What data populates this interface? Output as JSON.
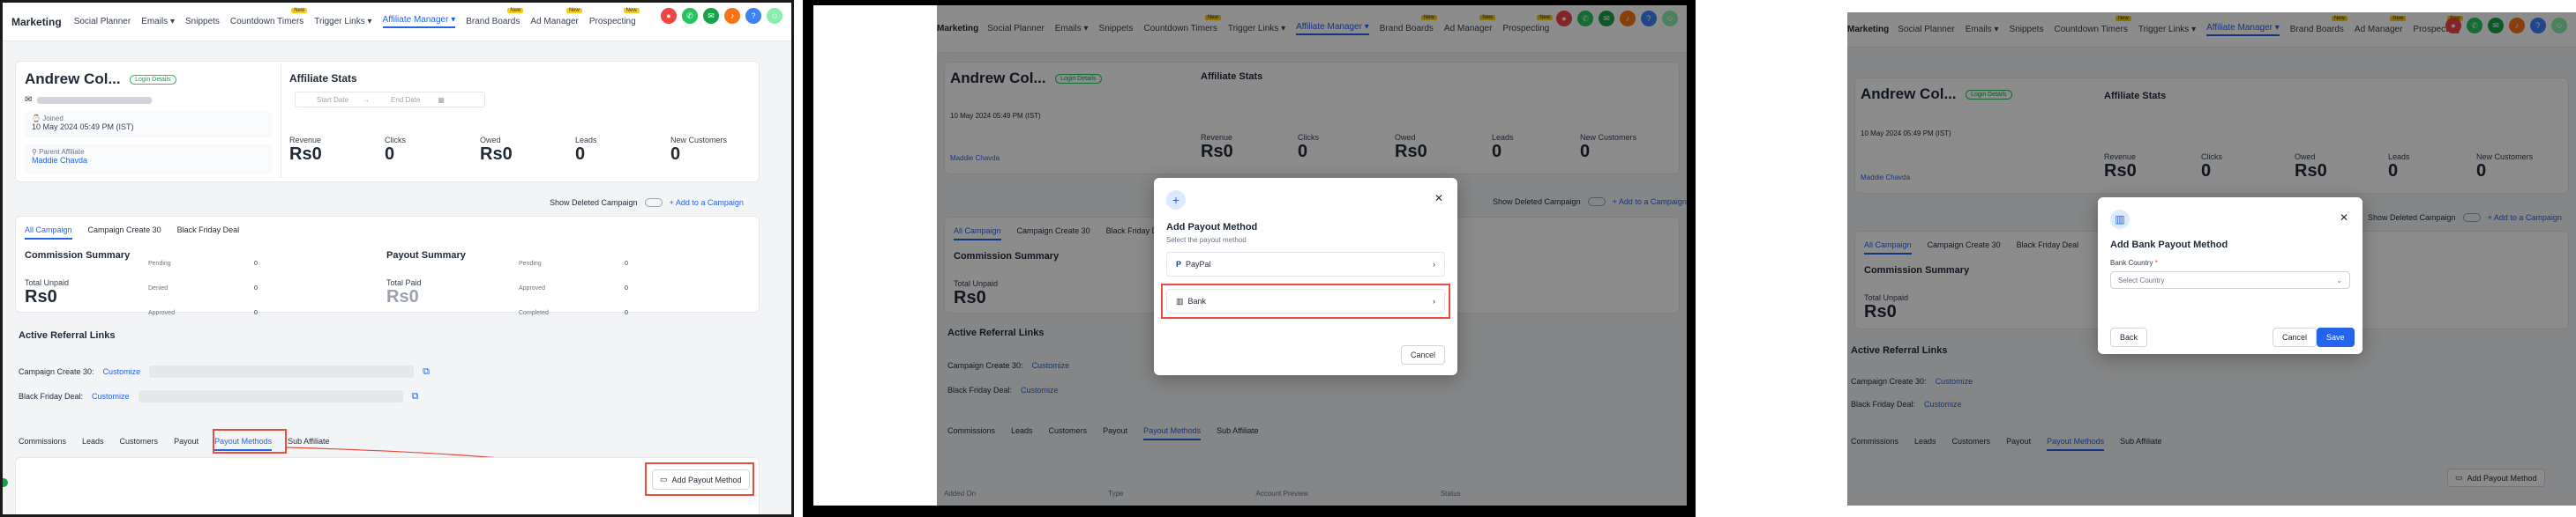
{
  "nav": {
    "brand": "Marketing",
    "items": [
      "Social Planner",
      "Emails",
      "Snippets",
      "Countdown Timers",
      "Trigger Links",
      "Affiliate Manager",
      "Brand Boards",
      "Ad Manager",
      "Prospecting"
    ],
    "new_badge": "New",
    "chevron": "▾"
  },
  "profile": {
    "name": "Andrew Col...",
    "login_details": "Login Details",
    "joined_label": "Joined",
    "joined_value": "10 May 2024 05:49 PM (IST)",
    "parent_label": "Parent Affiliate",
    "parent_value": "Maddie Chavda"
  },
  "stats": {
    "title": "Affiliate Stats",
    "start_placeholder": "Start Date",
    "end_placeholder": "End Date",
    "items": [
      {
        "label": "Revenue",
        "value": "Rs0"
      },
      {
        "label": "Clicks",
        "value": "0"
      },
      {
        "label": "Owed",
        "value": "Rs0"
      },
      {
        "label": "Leads",
        "value": "0"
      },
      {
        "label": "New Customers",
        "value": "0"
      }
    ]
  },
  "campaign_bar": {
    "show_deleted": "Show Deleted Campaign",
    "add_campaign": "+ Add to a Campaign"
  },
  "campaign_tabs": [
    "All Campaign",
    "Campaign Create 30",
    "Black Friday Deal"
  ],
  "commission": {
    "title": "Commission Summary",
    "total_unpaid_label": "Total Unpaid",
    "total_unpaid": "Rs0",
    "rows": [
      {
        "label": "Pending",
        "value": "0"
      },
      {
        "label": "Denied",
        "value": "0"
      },
      {
        "label": "Approved",
        "value": "0"
      }
    ]
  },
  "payout_summary": {
    "title": "Payout Summary",
    "total_paid_label": "Total Paid",
    "total_paid": "Rs0",
    "rows": [
      {
        "label": "Pending",
        "value": "0"
      },
      {
        "label": "Approved",
        "value": "0"
      },
      {
        "label": "Completed",
        "value": "0"
      }
    ]
  },
  "referral": {
    "title": "Active Referral Links",
    "links": [
      {
        "name": "Campaign Create 30:",
        "customize": "Customize"
      },
      {
        "name": "Black Friday Deal:",
        "customize": "Customize"
      }
    ]
  },
  "bottom_tabs": [
    "Commissions",
    "Leads",
    "Customers",
    "Payout",
    "Payout Methods",
    "Sub Affiliate"
  ],
  "add_payout_method": "Add Payout Method",
  "table_headers": [
    "Added On",
    "Type",
    "Account Preview",
    "Status"
  ],
  "modal_payout": {
    "title": "Add Payout Method",
    "subtitle": "Select the payout method",
    "options": [
      "PayPal",
      "Bank"
    ],
    "cancel": "Cancel"
  },
  "modal_bank": {
    "title": "Add Bank Payout Method",
    "country_label": "Bank Country",
    "required_mark": "*",
    "country_placeholder": "Select Country",
    "back": "Back",
    "cancel": "Cancel",
    "save": "Save"
  },
  "colors": {
    "accent": "#2563eb",
    "highlight": "#e74c3c",
    "success": "#16a34a"
  }
}
